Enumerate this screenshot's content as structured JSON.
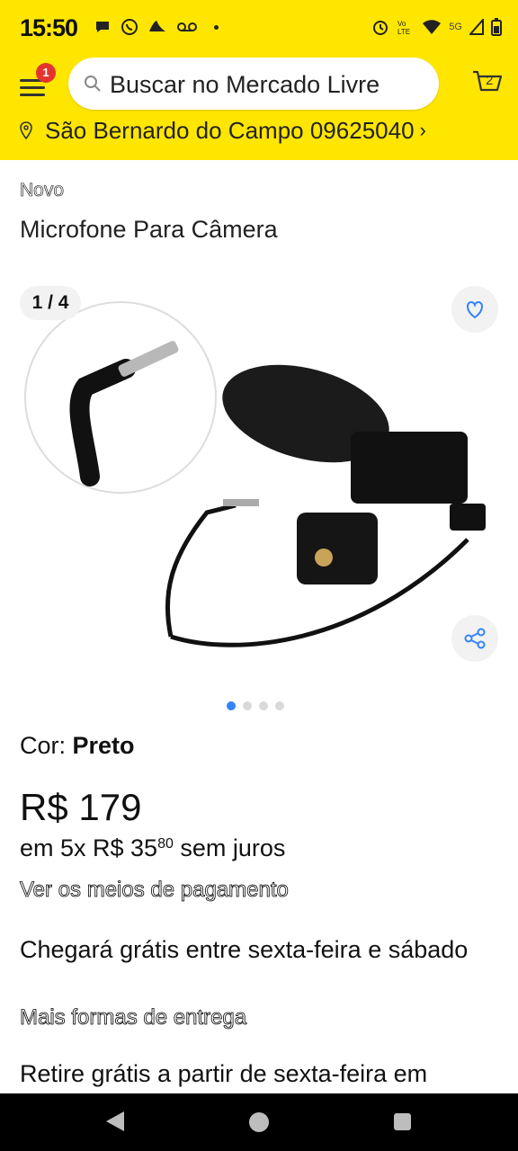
{
  "status": {
    "time": "15:50",
    "left_icons": [
      "chat-icon",
      "whatsapp-icon",
      "cloud-icon",
      "voicemail-icon"
    ],
    "right_icons": [
      "alarm-icon",
      "volte-icon",
      "wifi-icon",
      "signal-icon",
      "battery-icon"
    ],
    "network_label": "5G"
  },
  "header": {
    "menu_badge": "1",
    "search_placeholder": "Buscar no Mercado Livre",
    "cart_count": "2",
    "location": "São Bernardo do Campo 09625040"
  },
  "product": {
    "condition": "Novo",
    "title": "Microfone Para Câmera",
    "gallery_counter": "1 / 4",
    "gallery_total": 4,
    "gallery_active": 1,
    "color_label": "Cor: ",
    "color_value": "Preto",
    "price": "R$ 179",
    "installments_prefix": "em 5x R$ 35",
    "installments_cents": "80",
    "installments_suffix": " sem juros",
    "payment_link": "Ver os meios de pagamento",
    "delivery_text": "Chegará grátis entre sexta-feira e sábado",
    "delivery_link": "Mais formas de entrega",
    "pickup_text": "Retire grátis a partir de sexta-feira em"
  },
  "colors": {
    "brand_yellow": "#ffe600",
    "accent_blue": "#3483fa",
    "badge_red": "#e3342f"
  }
}
